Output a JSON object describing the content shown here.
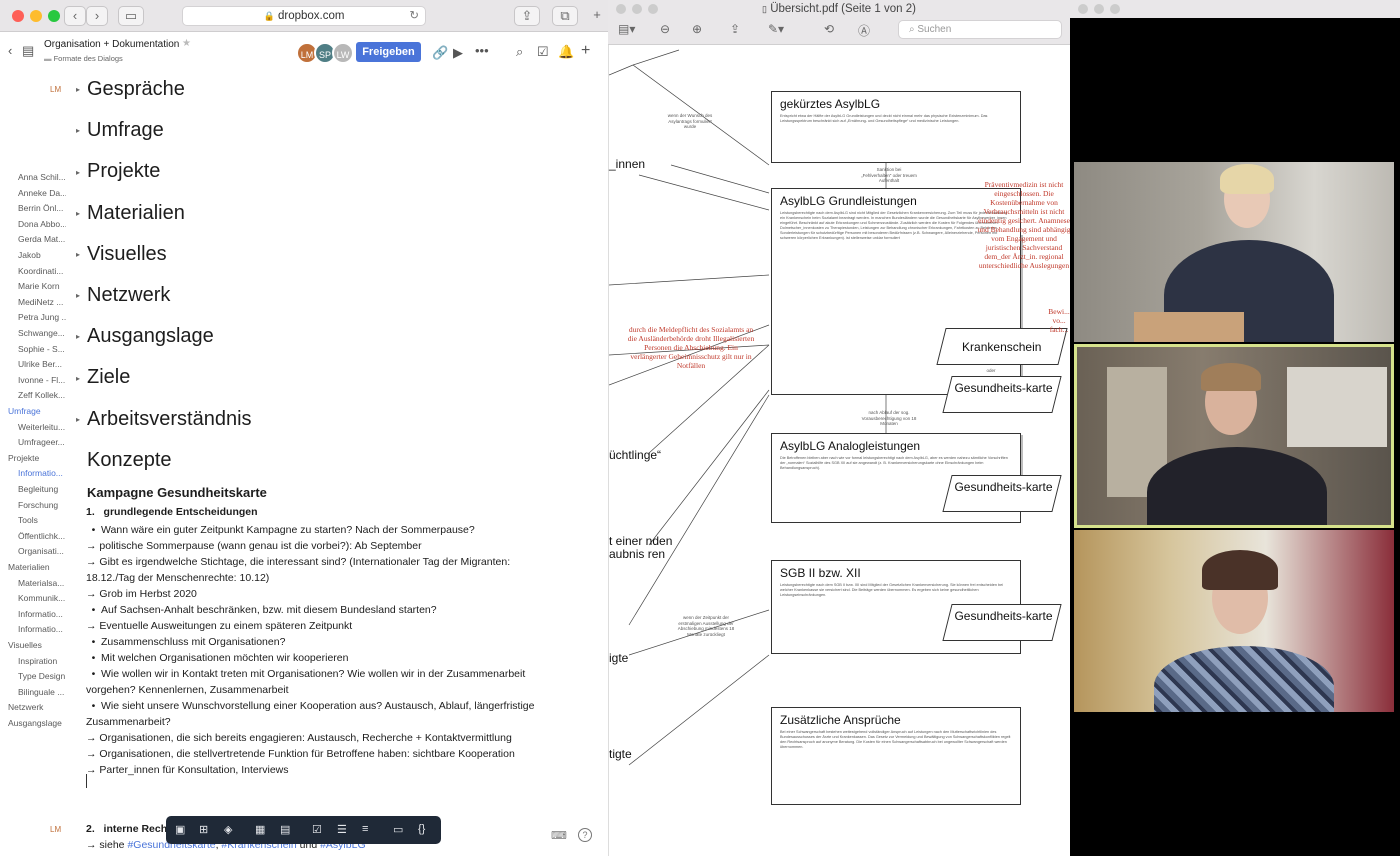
{
  "safari": {
    "url": "dropbox.com",
    "doc_title": "Organisation + Dokumentation",
    "folder": "Formate des Dialogs",
    "avatars": [
      "LM",
      "SP",
      "LW"
    ],
    "share_label": "Freigeben",
    "author_tag": "LM",
    "sidebar": [
      {
        "label": "Anna Schil...",
        "level": 2
      },
      {
        "label": "Anneke Da...",
        "level": 2
      },
      {
        "label": "Berrin Önl...",
        "level": 2
      },
      {
        "label": "Dona Abbo...",
        "level": 2
      },
      {
        "label": "Gerda Mat...",
        "level": 2
      },
      {
        "label": "Jakob",
        "level": 2
      },
      {
        "label": "Koordinati...",
        "level": 2
      },
      {
        "label": "Marie Korn",
        "level": 2
      },
      {
        "label": "MediNetz ...",
        "level": 2
      },
      {
        "label": "Petra Jung ...",
        "level": 2
      },
      {
        "label": "Schwange...",
        "level": 2
      },
      {
        "label": "Sophie - S...",
        "level": 2
      },
      {
        "label": "Ulrike Ber...",
        "level": 2
      },
      {
        "label": "Ivonne - Fl...",
        "level": 2
      },
      {
        "label": "Zeff Kollek...",
        "level": 2
      },
      {
        "label": "Umfrage",
        "level": 1,
        "active": true
      },
      {
        "label": "Weiterleitu...",
        "level": 2
      },
      {
        "label": "Umfrageer...",
        "level": 2
      },
      {
        "label": "Projekte",
        "level": 1
      },
      {
        "label": "Informatio...",
        "level": 2,
        "active": true
      },
      {
        "label": "Begleitung",
        "level": 2
      },
      {
        "label": "Forschung",
        "level": 2
      },
      {
        "label": "Tools",
        "level": 2
      },
      {
        "label": "Öffentlichk...",
        "level": 2
      },
      {
        "label": "Organisati...",
        "level": 2
      },
      {
        "label": "Materialien",
        "level": 1
      },
      {
        "label": "Materialsa...",
        "level": 2
      },
      {
        "label": "Kommunik...",
        "level": 2
      },
      {
        "label": "Informatio...",
        "level": 2
      },
      {
        "label": "Informatio...",
        "level": 2
      },
      {
        "label": "Visuelles",
        "level": 1
      },
      {
        "label": "Inspiration",
        "level": 2
      },
      {
        "label": "Type Design",
        "level": 2
      },
      {
        "label": "Bilinguale ...",
        "level": 2
      },
      {
        "label": "Netzwerk",
        "level": 1
      },
      {
        "label": "Ausgangslage",
        "level": 1
      }
    ],
    "sections": [
      "Gespräche",
      "Umfrage",
      "Projekte",
      "Materialien",
      "Visuelles",
      "Netzwerk",
      "Ausgangslage",
      "Ziele",
      "Arbeitsverständnis"
    ],
    "concepts_heading": "Konzepte",
    "campaign_heading": "Kampagne Gesundheitskarte",
    "list_item_1": "grundlegende Entscheidungen",
    "lines": [
      {
        "b": "•",
        "t": "Wann wäre ein guter Zeitpunkt Kampagne zu starten? Nach der Sommerpause?"
      },
      {
        "b": "",
        "t": "→ politische Sommerpause (wann genau ist die vorbei?): Ab September"
      },
      {
        "b": "",
        "t": "→ Gibt es irgendwelche Stichtage, die interessant sind? (Internationaler Tag der Migranten: 18.12./Tag der Menschenrechte: 10.12)"
      },
      {
        "b": "",
        "t": "→ Grob im Herbst 2020"
      },
      {
        "b": "•",
        "t": "Auf Sachsen-Anhalt beschränken, bzw. mit diesem Bundesland starten?"
      },
      {
        "b": "",
        "t": "→ Eventuelle Ausweitungen zu einem späteren Zeitpunkt"
      },
      {
        "b": "•",
        "t": "Zusammenschluss mit Organisationen?"
      },
      {
        "b": "•",
        "t": "Mit welchen Organisationen möchten wir kooperieren"
      },
      {
        "b": "•",
        "t": "Wie wollen wir in Kontakt treten mit Organisationen? Wie wollen wir in der Zusammenarbeit vorgehen? Kennenlernen, Zusammenarbeit"
      },
      {
        "b": "•",
        "t": "Wie sieht unsere Wunschvorstellung einer Kooperation aus? Austausch, Ablauf, längerfristige Zusammenarbeit?"
      },
      {
        "b": "",
        "t": "→ Organisationen, die sich bereits engagieren: Austausch, Recherche + Kontaktvermittlung"
      },
      {
        "b": "",
        "t": "→ Organisationen, die stellvertretende Funktion für Betroffene haben: sichtbare Kooperation"
      },
      {
        "b": "",
        "t": "→ Parter_innen für Konsultation, Interviews"
      }
    ],
    "list_item_2": "interne Reche",
    "last_line_prefix": "→ siehe ",
    "tags": [
      "#Gesundheitskarte",
      "#Krankenschein",
      "#AsylbLG"
    ],
    "tag_separator_1": ", ",
    "tag_separator_2": " und "
  },
  "preview": {
    "title": "Übersicht.pdf (Seite 1 von 2)",
    "search_placeholder": "Suchen",
    "boxes": [
      {
        "title": "gekürztes AsylbLG",
        "body": "Entspricht etwa der Hälfte der AsylbLG Grundleistungen und deckt nicht einmal mehr das physische Existenzminimum. Das Leistungsspektrum beschränkt sich auf „Ernährung- und Gesundheitspflege“ und medizinische Leistungen."
      },
      {
        "title": "AsylbLG Grundleistungen",
        "body": "Leistungsberechtigte nach dem AsylbLG sind nicht Mitglied der Gesetzlichen Krankenversicherung. Zum Teil muss für jede Behandlung ein Krankenschein beim Sozialamt beantragt werden. In manchen Bundesländern wurde die Gesundheitskarte für Asylbewerber_innen eingeführt. Beschränkt auf akute Erkrankungen und Schmerzzustände. Zusätzlich werden die Kosten für Folgendes übernommen: Dolmetscher_innenkosten zu Therapiestunden, Leistungen zur Behandlung chronischer Erkrankungen, Fahrtkosten zu Behörden. Sonderleistungen für schutzbedürftige Personen mit besonderen Bedürfnissen (z.B. Schwangere, Alleinerziehende, Personen mit schweren körperlichen Erkrankungen). ist stellenweise unklar formuliert"
      },
      {
        "title": "AsylbLG Analogleistungen",
        "body": "Die Betroffenen bleiben aber nach wie vor formal leistungsberechtigt nach dem AsylbLG, aber es werden nahezu sämtliche Vorschriften der „normalen“ Sozialhilfe des SGB XII auf sie angewandt (z. B. Krankenversicherungskarte ohne Einschränkungen beim Behandlungsanspruch)."
      },
      {
        "title": "SGB II bzw. XII",
        "body": "Leistungsberechtigte nach dem SGB II bzw. XII sind Mitglied der Gesetzlichen Krankenversicherung. Sie können frei entscheiden bei welcher Krankenkasse sie versichert sind. Die Beiträge werden übernommen. Es ergeben sich keine gesundheitlichen Leistungseinschränkungen."
      },
      {
        "title": "Zusätzliche Ansprüche",
        "body": "Bei einer Schwangerschaft bestehen weitestgehend vollständiger Anspruch auf Leistungen nach den Mutterschaftsrichtlinien des Bundesausschusses der Ärzte und Krankenkassen. Das Gesetz zur Vermeidung und Bewältigung von Schwangerschaftskonflikten regelt den Rechtsanspruch auf anonyme Beratung. Die Kosten für einen Schwangerschaftsabbruch bei ungewollter Schwangerschaft werden übernommen."
      }
    ],
    "para_labels": [
      "Krankenschein",
      "Gesundheits-karte",
      "Gesundheits-karte",
      "Gesundheits-karte"
    ],
    "red_note_1": "Präventivmedizin ist nicht eingeschlossen. Die Kostenübernahme von Verbrauchsmitteln ist nicht eindeutig gesichert. Anamnese und Behandlung sind abhängig vom Engagement und juristischen Sachverstand dem_der Ärzt_in. regional unterschiedliche Auslegungen",
    "red_note_2": "durch die Meldepflicht des Sozialamts an die Ausländerbehörde droht Illegalisierten Personen die Abschiebung. Ein verlängerter Geheimnisschutz gilt nur in Notfällen",
    "red_note_3": "Bewi... vo... fach...",
    "left_fragments": [
      "_innen",
      "üchtlinge“",
      "t einer nden aubnis ren",
      "igte",
      "tigte"
    ],
    "arrow_notes": [
      "wenn der Wunsch des Asylantrags formuliert wurde",
      "Sanktion bei „Fehlverhalten“ oder treuem Aufenthalt",
      "nach Ablauf der sog. Vorausberechtigung von 18 Monaten",
      "wenn der Zeitpunkt der erstmaligen Ausstellung der Abschiebung mindestens 18 Monate zurückliegt",
      "oder"
    ]
  },
  "colors": {
    "accent": "#4a74d9",
    "red_annotation": "#c0392b",
    "active_speaker_border": "#d6e28c"
  }
}
